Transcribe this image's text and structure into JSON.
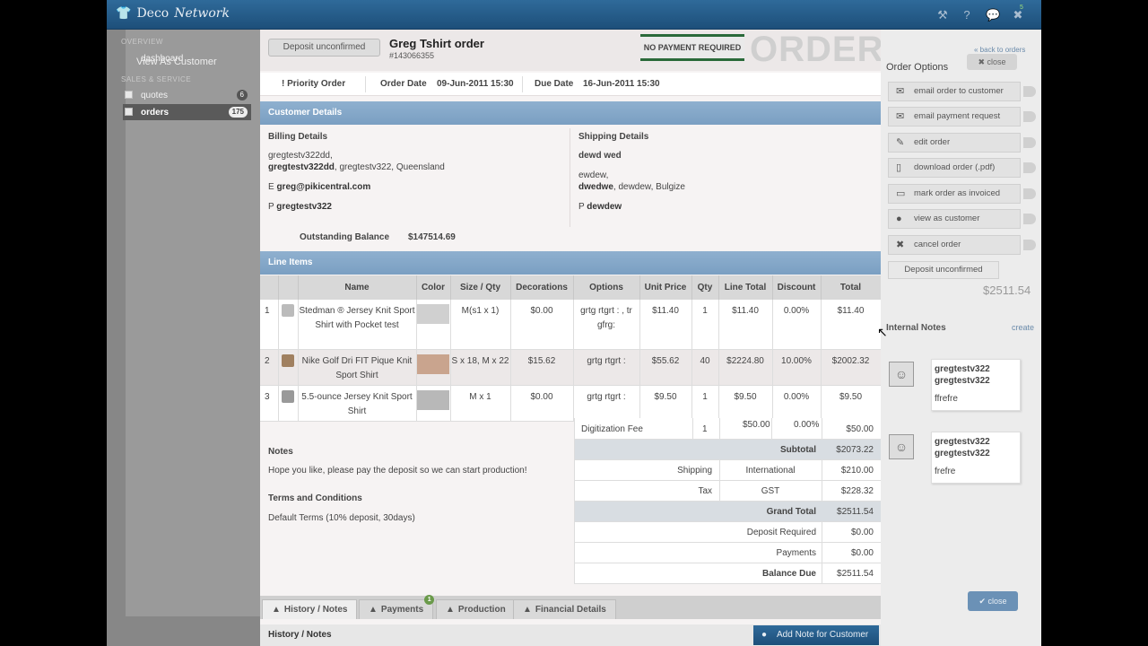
{
  "app": {
    "logo_text": "Deco",
    "logo_script": "Network"
  },
  "top_icons": {
    "tools": "wrench-icon",
    "help": "help-icon",
    "messages": "chat-icon",
    "messages_count": "5",
    "close": "close-icon"
  },
  "sidebar": {
    "overview_heading": "OVERVIEW",
    "dashboard": "dashboard",
    "view_as_customer": "View As Customer",
    "sales_heading": "SALES & SERVICE",
    "items": [
      {
        "label": "quotes",
        "count": "6"
      },
      {
        "label": "orders",
        "count": "175"
      }
    ]
  },
  "order": {
    "status_pill": "Deposit unconfirmed",
    "title": "Greg Tshirt order",
    "number": "#143066355",
    "payment_banner": "NO PAYMENT REQUIRED",
    "stamp": "ORDER",
    "priority": "! Priority Order",
    "order_date_label": "Order Date",
    "order_date": "09-Jun-2011 15:30",
    "due_date_label": "Due Date",
    "due_date": "16-Jun-2011 15:30"
  },
  "customer": {
    "section_title": "Customer Details",
    "billing_title": "Billing Details",
    "billing_line1": "gregtestv322dd,",
    "billing_line2_bold": "gregtestv322dd",
    "billing_line2_rest": ", gregtestv322, Queensland",
    "email_prefix": "E",
    "email": "greg@pikicentral.com",
    "phone_prefix": "P",
    "phone": "gregtestv322",
    "balance_label": "Outstanding Balance",
    "balance_value": "$147514.69",
    "shipping_title": "Shipping Details",
    "ship_name": "dewd wed",
    "ship_line1": "ewdew,",
    "ship_line2_bold": "dwedwe",
    "ship_line2_rest": ", dewdew, Bulgize",
    "ship_phone_prefix": "P",
    "ship_phone": "dewdew"
  },
  "line_items": {
    "section_title": "Line Items",
    "headers": [
      "",
      "",
      "Name",
      "Color",
      "Size / Qty",
      "Decorations",
      "Options",
      "Unit Price",
      "Qty",
      "Line Total",
      "Discount",
      "Total"
    ],
    "rows": [
      {
        "n": "1",
        "name": "Stedman ® Jersey Knit Sport Shirt with Pocket test",
        "color": "#d0d0d0",
        "size": "M(s1 x 1)",
        "deco": "$0.00",
        "options": "grtg rtgrt : , tr gfrg:",
        "unit": "$11.40",
        "qty": "1",
        "line_total": "$11.40",
        "discount": "0.00%",
        "total": "$11.40"
      },
      {
        "n": "2",
        "name": "Nike Golf Dri FIT Pique Knit Sport Shirt",
        "color": "#c9a48e",
        "size": "S x 18, M x 22",
        "deco": "$15.62",
        "options": "grtg rtgrt :",
        "unit": "$55.62",
        "qty": "40",
        "line_total": "$2224.80",
        "discount": "10.00%",
        "total": "$2002.32"
      },
      {
        "n": "3",
        "name": "5.5-ounce Jersey Knit Sport Shirt",
        "color": "#b8b8b8",
        "size": "M x 1",
        "deco": "$0.00",
        "options": "grtg rtgrt :",
        "unit": "$9.50",
        "qty": "1",
        "line_total": "$9.50",
        "discount": "0.00%",
        "total": "$9.50"
      }
    ],
    "digitization": {
      "label": "Digitization Fee",
      "qty": "1",
      "line_total": "$50.00",
      "discount": "0.00%",
      "total": "$50.00"
    }
  },
  "notes": {
    "notes_title": "Notes",
    "notes_text": "Hope you like, please pay the deposit so we can start production!",
    "terms_title": "Terms and Conditions",
    "terms_text": "Default Terms (10% deposit, 30days)"
  },
  "totals": {
    "subtotal_label": "Subtotal",
    "subtotal": "$2073.22",
    "shipping_label": "Shipping",
    "shipping_method": "International",
    "shipping": "$210.00",
    "tax_label": "Tax",
    "tax_type": "GST",
    "tax": "$228.32",
    "grand_label": "Grand Total",
    "grand": "$2511.54",
    "deposit_label": "Deposit Required",
    "deposit": "$0.00",
    "payments_label": "Payments",
    "payments": "$0.00",
    "balance_label": "Balance Due",
    "balance": "$2511.54"
  },
  "tabs": [
    {
      "label": "History / Notes"
    },
    {
      "label": "Payments",
      "badge": "1"
    },
    {
      "label": "Production"
    },
    {
      "label": "Financial Details"
    }
  ],
  "history": {
    "title": "History / Notes",
    "add_note": "Add Note for Customer"
  },
  "right": {
    "back_link": "« back to orders",
    "close": "close",
    "options_title": "Order Options",
    "options": [
      {
        "label": "email order to customer",
        "icon": "mail-icon"
      },
      {
        "label": "email payment request",
        "icon": "mail-icon"
      },
      {
        "label": "edit order",
        "icon": "pencil-icon"
      },
      {
        "label": "download order (.pdf)",
        "icon": "document-icon"
      },
      {
        "label": "mark order as invoiced",
        "icon": "comment-icon"
      },
      {
        "label": "view as customer",
        "icon": "user-icon"
      },
      {
        "label": "cancel order",
        "icon": "cross-icon"
      }
    ],
    "deposit_state": "Deposit unconfirmed",
    "amount": "$2511.54",
    "notes_title": "Internal Notes",
    "create_link": "create",
    "notes": [
      {
        "who1": "gregtestv322",
        "who2": "gregtestv322",
        "msg": "ffrefre"
      },
      {
        "who1": "gregtestv322",
        "who2": "gregtestv322",
        "msg": "frefre"
      }
    ],
    "close_bottom": "close"
  }
}
